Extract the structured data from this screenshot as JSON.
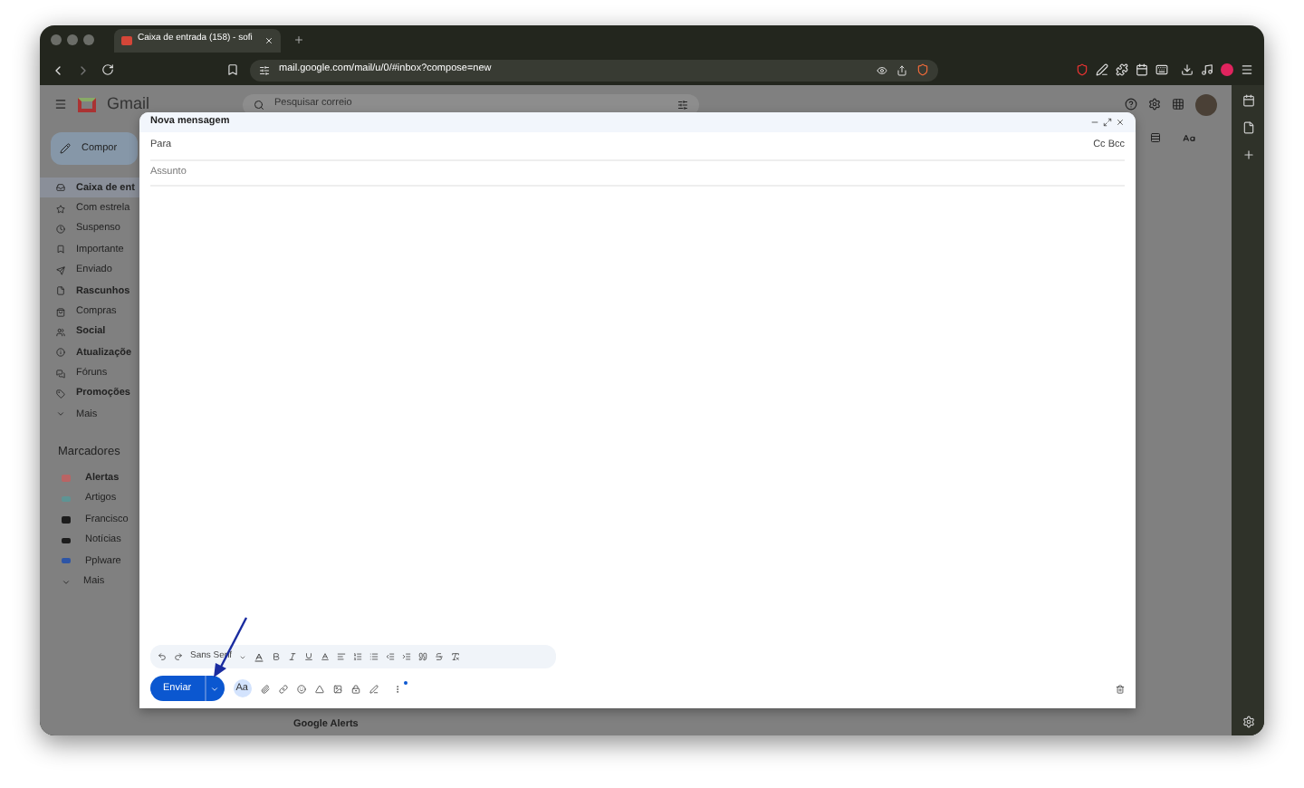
{
  "browser": {
    "tab": {
      "title": "Caixa de entrada (158) - sofi"
    },
    "url": "mail.google.com/mail/u/0/#inbox?compose=new"
  },
  "gmail": {
    "logo_text": "Gmail",
    "search": {
      "placeholder": "Pesquisar correio"
    },
    "compose_button": "Compor",
    "nav": [
      {
        "label": "Caixa de ent",
        "selected": true,
        "unread": true
      },
      {
        "label": "Com estrela",
        "selected": false,
        "unread": false
      },
      {
        "label": "Suspenso",
        "selected": false,
        "unread": false
      },
      {
        "label": "Importante",
        "selected": false,
        "unread": false
      },
      {
        "label": "Enviado",
        "selected": false,
        "unread": false
      },
      {
        "label": "Rascunhos",
        "selected": false,
        "unread": true
      },
      {
        "label": "Compras",
        "selected": false,
        "unread": false
      },
      {
        "label": "Social",
        "selected": false,
        "unread": true
      },
      {
        "label": "Atualizaçõe",
        "selected": false,
        "unread": true
      },
      {
        "label": "Fóruns",
        "selected": false,
        "unread": false
      },
      {
        "label": "Promoções",
        "selected": false,
        "unread": true
      },
      {
        "label": "Mais",
        "selected": false,
        "unread": false
      }
    ],
    "labels_heading": "Marcadores",
    "labels": [
      {
        "label": "Alertas",
        "color": "#b96464",
        "unread": true
      },
      {
        "label": "Artigos",
        "color": "#5e9494",
        "unread": false
      },
      {
        "label": "Francisco",
        "color": "#1c1c1c",
        "unread": false
      },
      {
        "label": "Notícias",
        "color": "#1c1c1c",
        "unread": false
      },
      {
        "label": "Pplware",
        "color": "#2d55a6",
        "unread": false
      }
    ],
    "labels_more": "Mais",
    "partial_row": "Google Alerts"
  },
  "compose": {
    "title": "Nova mensagem",
    "to_label": "Para",
    "cc_bcc": "Cc Bcc",
    "subject_placeholder": "Assunto",
    "font": "Sans Serif",
    "send": "Enviar",
    "format_toggle": "Aa"
  }
}
